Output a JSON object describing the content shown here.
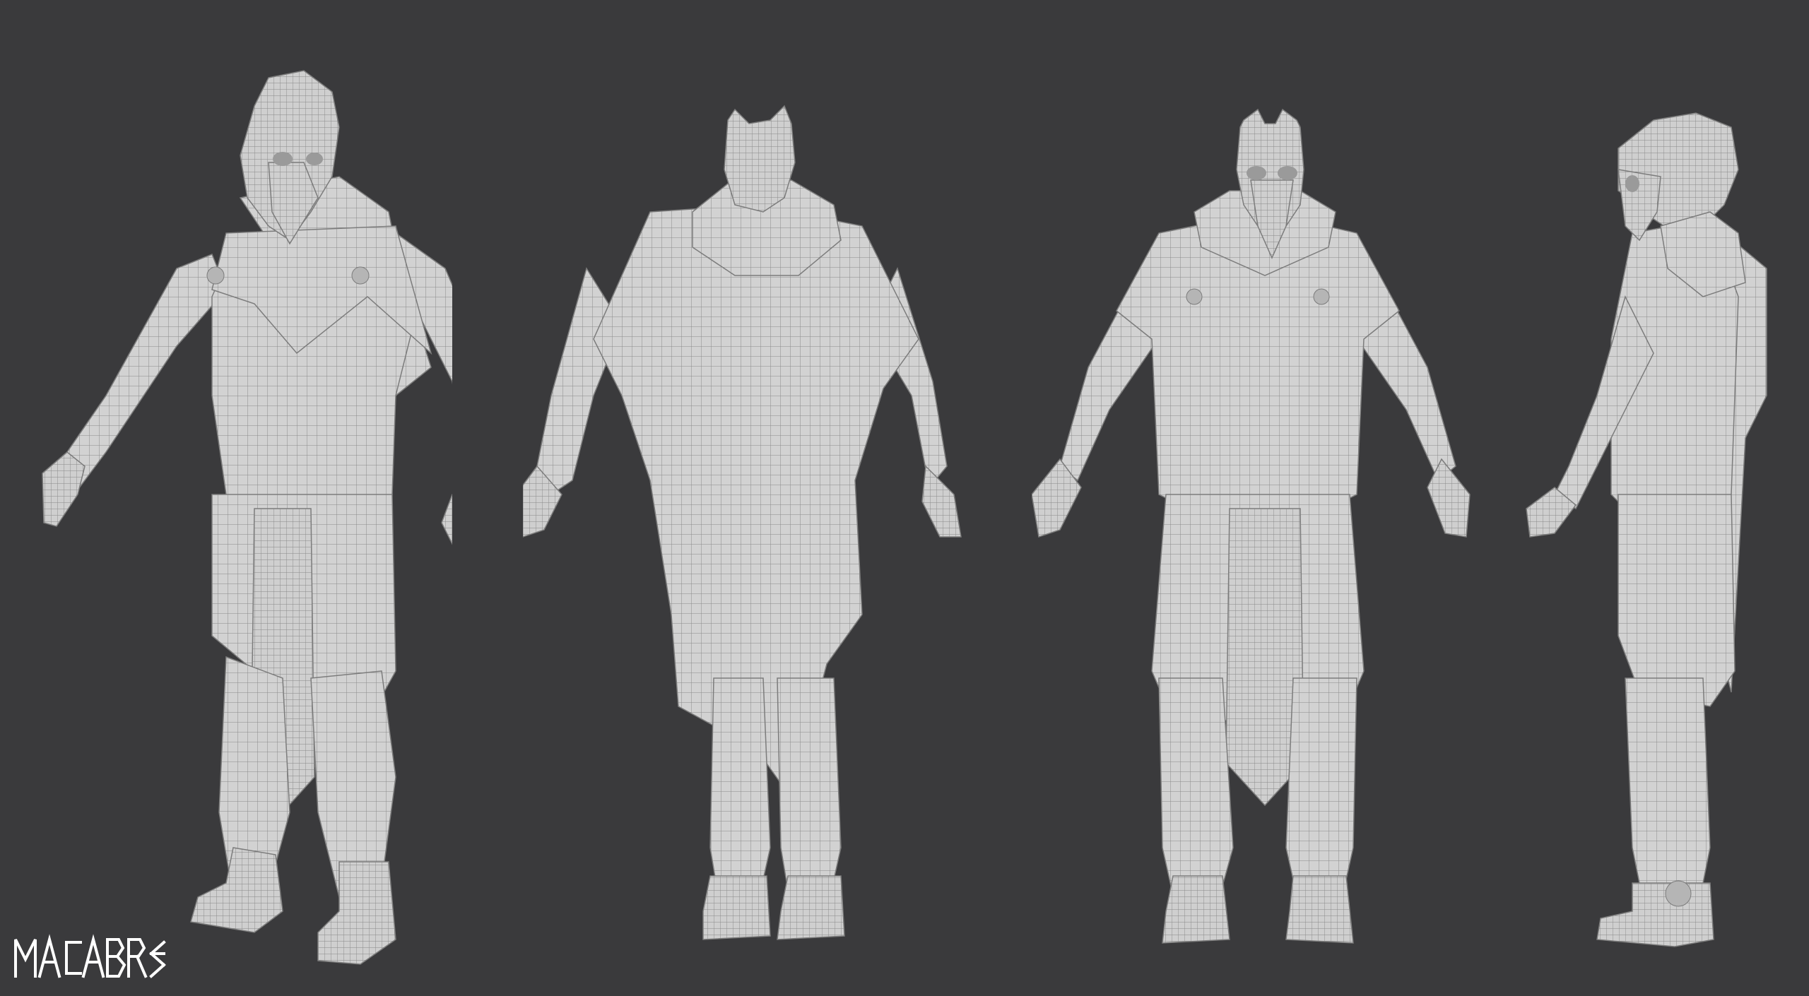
{
  "render": {
    "background_color": "#3a3a3c",
    "material_color": "#d4d4d4",
    "wire_color": "#8e8e8e",
    "shadow_color": "#9d9d9d"
  },
  "views": [
    {
      "id": "three-quarter",
      "icon": "character-turnaround-three-quarter"
    },
    {
      "id": "back",
      "icon": "character-turnaround-back"
    },
    {
      "id": "front",
      "icon": "character-turnaround-front"
    },
    {
      "id": "side",
      "icon": "character-turnaround-side"
    }
  ],
  "logo": {
    "text": "MACABRE",
    "color": "#ffffff"
  }
}
